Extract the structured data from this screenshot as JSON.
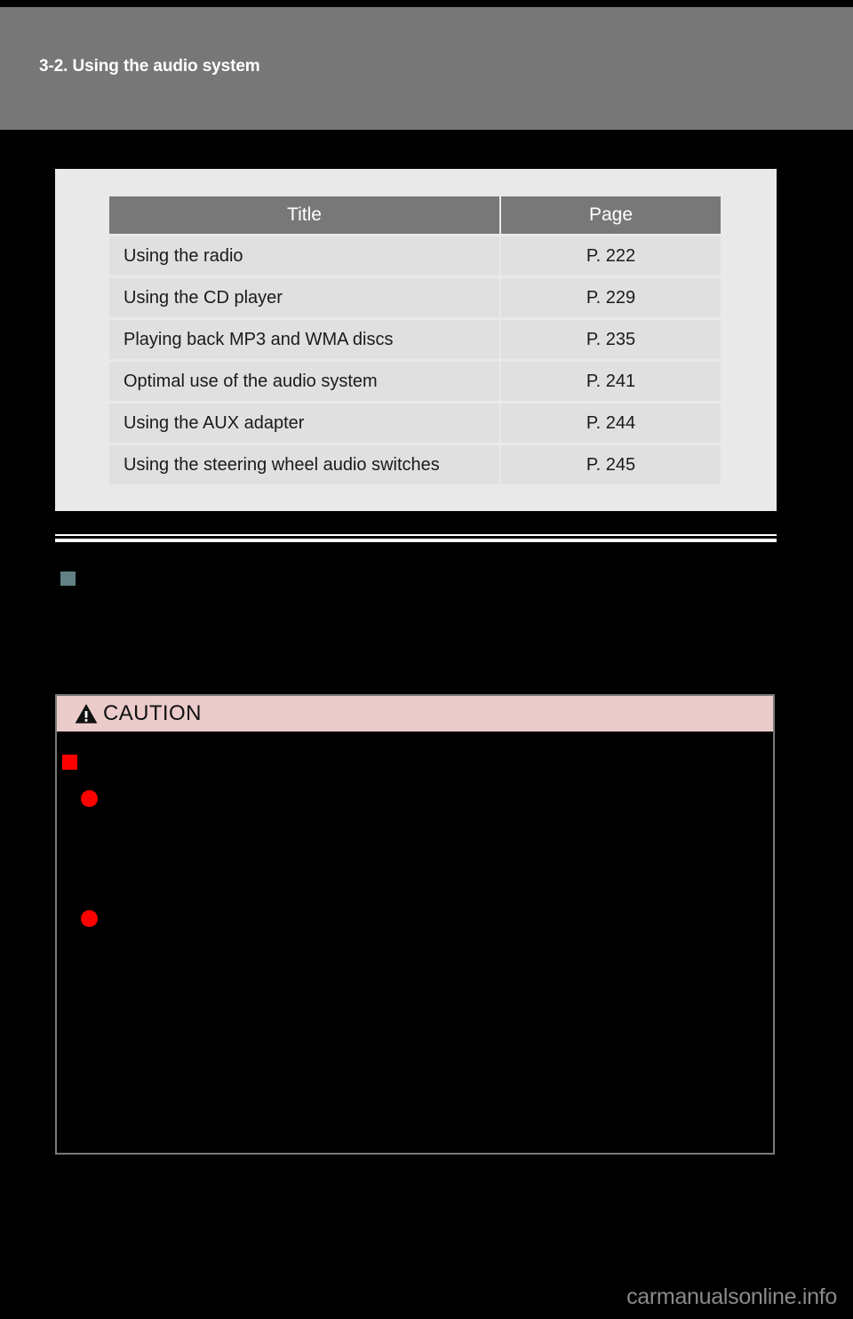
{
  "page": {
    "header_title": "3-2. Using the audio system",
    "background_color": "#000000",
    "header_band_color": "#777777"
  },
  "toc": {
    "panel_color": "#e9e9e9",
    "header_row_color": "#787878",
    "row_color": "#e0e0e0",
    "columns": [
      "Title",
      "Page"
    ],
    "rows": [
      {
        "title": "Using the radio",
        "page": "P. 222"
      },
      {
        "title": "Using the CD player",
        "page": "P. 229"
      },
      {
        "title": "Playing back MP3 and WMA discs",
        "page": "P. 235"
      },
      {
        "title": "Optimal use of the audio system",
        "page": "P. 241"
      },
      {
        "title": "Using the AUX adapter",
        "page": "P. 244"
      },
      {
        "title": "Using the steering wheel audio switches",
        "page": "P. 245"
      }
    ]
  },
  "section": {
    "bullet_color": "#628184"
  },
  "caution": {
    "label": "CAUTION",
    "header_color": "#eccccb",
    "border_color": "#7a7a7a",
    "bullet_color": "#ff0000",
    "icon": "warning-triangle-icon"
  },
  "footer": {
    "watermark": "carmanualsonline.info",
    "watermark_color": "#8a8a8a"
  }
}
